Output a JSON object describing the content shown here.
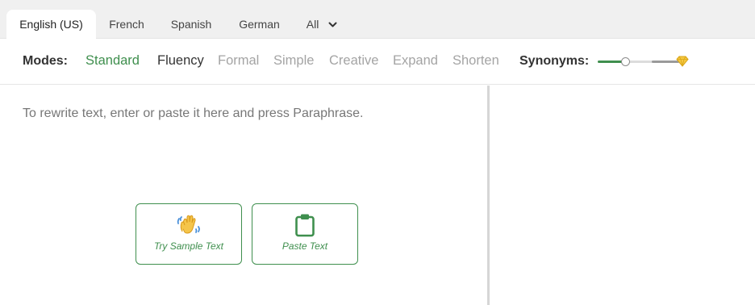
{
  "language_tabs": [
    {
      "label": "English (US)",
      "active": true
    },
    {
      "label": "French"
    },
    {
      "label": "Spanish"
    },
    {
      "label": "German"
    },
    {
      "label": "All"
    }
  ],
  "modes": {
    "label": "Modes:",
    "items": [
      "Standard",
      "Fluency",
      "Formal",
      "Simple",
      "Creative",
      "Expand",
      "Shorten"
    ],
    "active": "Standard"
  },
  "synonyms": {
    "label": "Synonyms:",
    "level": 0.33
  },
  "editor": {
    "placeholder": "To rewrite text, enter or paste it here and press Paraphrase.",
    "try_sample_label": "Try Sample Text",
    "paste_label": "Paste Text"
  },
  "colors": {
    "accent": "#3f8f4e",
    "inactive_text": "#a4a4a4",
    "premium_gold": "#f2c12e"
  },
  "icons": {
    "dropdown": "chevron-down-icon",
    "sample": "waving-hands-icon",
    "paste": "clipboard-icon",
    "premium": "diamond-icon"
  }
}
